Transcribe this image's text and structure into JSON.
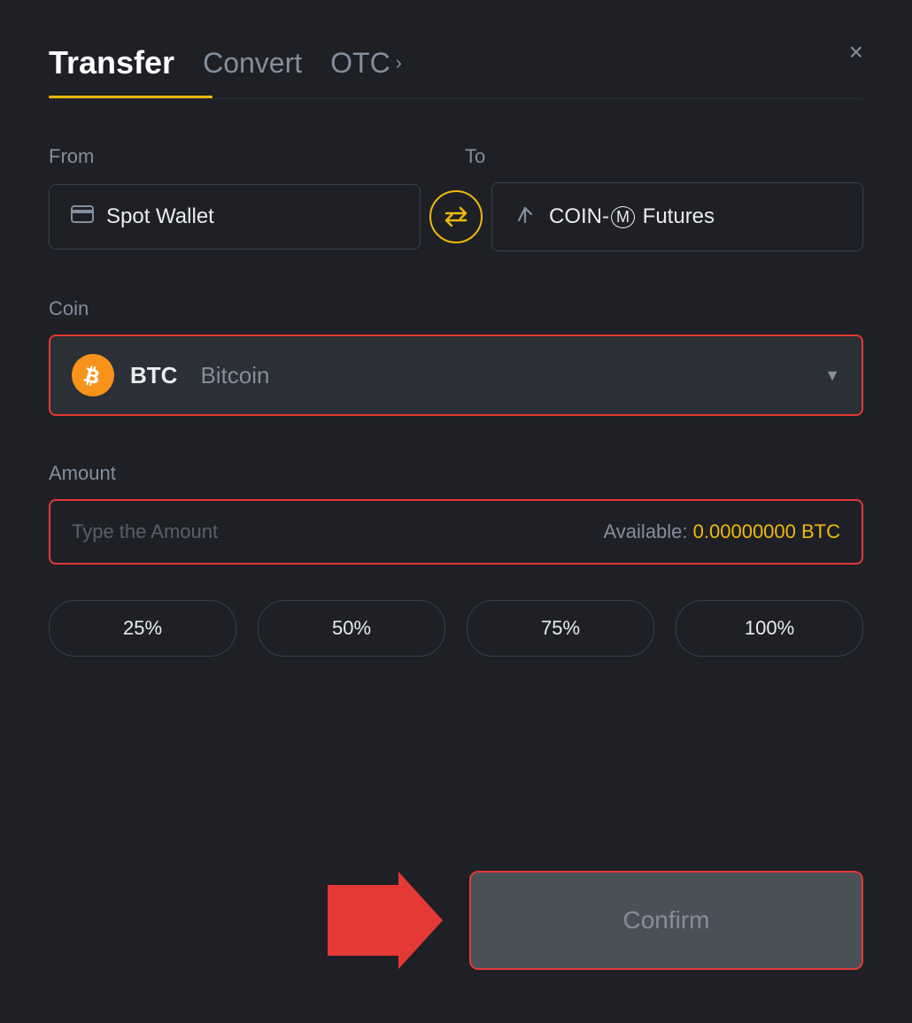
{
  "header": {
    "tab_transfer": "Transfer",
    "tab_convert": "Convert",
    "tab_otc": "OTC",
    "tab_otc_chevron": "›",
    "close_label": "×"
  },
  "from_section": {
    "label": "From",
    "wallet_icon": "▬",
    "wallet_name": "Spot Wallet"
  },
  "to_section": {
    "label": "To",
    "futures_name": "COIN-M Futures"
  },
  "swap": {
    "icon": "⇄"
  },
  "coin_section": {
    "label": "Coin",
    "coin_symbol": "BTC",
    "coin_name": "Bitcoin",
    "dropdown_arrow": "▼"
  },
  "amount_section": {
    "label": "Amount",
    "placeholder": "Type the Amount",
    "available_label": "Available:",
    "available_value": "0.00000000 BTC"
  },
  "percentage_buttons": [
    {
      "label": "25%"
    },
    {
      "label": "50%"
    },
    {
      "label": "75%"
    },
    {
      "label": "100%"
    }
  ],
  "confirm": {
    "button_label": "Confirm"
  }
}
